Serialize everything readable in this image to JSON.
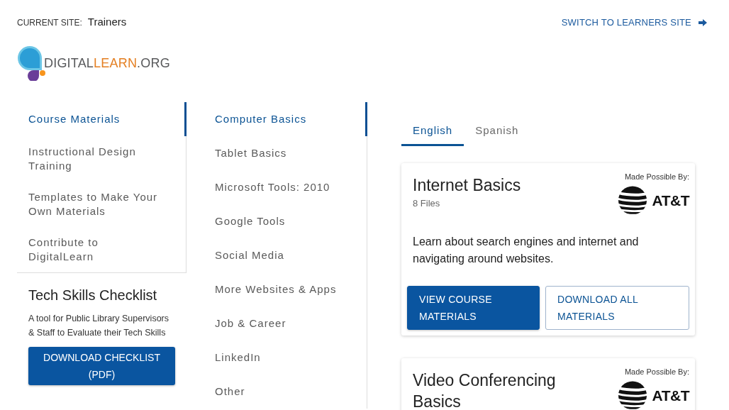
{
  "header": {
    "current_site_label": "CURRENT SITE:",
    "current_site": "Trainers",
    "switch_link": "SWITCH TO LEARNERS SITE"
  },
  "logo": {
    "segments": [
      {
        "text": "DIGITAL",
        "color": "#58595b"
      },
      {
        "text": "LEARN",
        "color": "#e47f22"
      },
      {
        "text": ".ORG",
        "color": "#58595b"
      }
    ]
  },
  "sidebar": {
    "items": [
      {
        "label": "Course Materials",
        "selected": true
      },
      {
        "label": "Instructional Design Training",
        "selected": false
      },
      {
        "label": "Templates to Make Your Own Materials",
        "selected": false
      },
      {
        "label": "Contribute to DigitalLearn",
        "selected": false
      }
    ]
  },
  "checklist": {
    "title": "Tech Skills Checklist",
    "description": "A tool for Public Library Supervisors & Staff to Evaluate their Tech Skills",
    "button": "DOWNLOAD CHECKLIST (PDF)"
  },
  "categories": {
    "items": [
      {
        "label": "Computer Basics",
        "selected": true
      },
      {
        "label": "Tablet Basics",
        "selected": false
      },
      {
        "label": "Microsoft Tools: 2010",
        "selected": false
      },
      {
        "label": "Google Tools",
        "selected": false
      },
      {
        "label": "Social Media",
        "selected": false
      },
      {
        "label": "More Websites & Apps",
        "selected": false
      },
      {
        "label": "Job & Career",
        "selected": false
      },
      {
        "label": "LinkedIn",
        "selected": false
      },
      {
        "label": "Other",
        "selected": false
      }
    ]
  },
  "tabs": [
    {
      "label": "English",
      "selected": true
    },
    {
      "label": "Spanish",
      "selected": false
    }
  ],
  "courses": [
    {
      "title": "Internet Basics",
      "file_count": "8 Files",
      "sponsor_label": "Made Possible By:",
      "sponsor_name": "AT&T",
      "description": "Learn about search engines and internet and navigating around websites.",
      "buttons": [
        {
          "label": "VIEW COURSE MATERIALS",
          "kind": "primary"
        },
        {
          "label": "DOWNLOAD ALL MATERIALS",
          "kind": "outline"
        }
      ]
    },
    {
      "title": "Video Conferencing Basics",
      "sponsor_label": "Made Possible By:",
      "sponsor_name": "AT&T"
    }
  ]
}
